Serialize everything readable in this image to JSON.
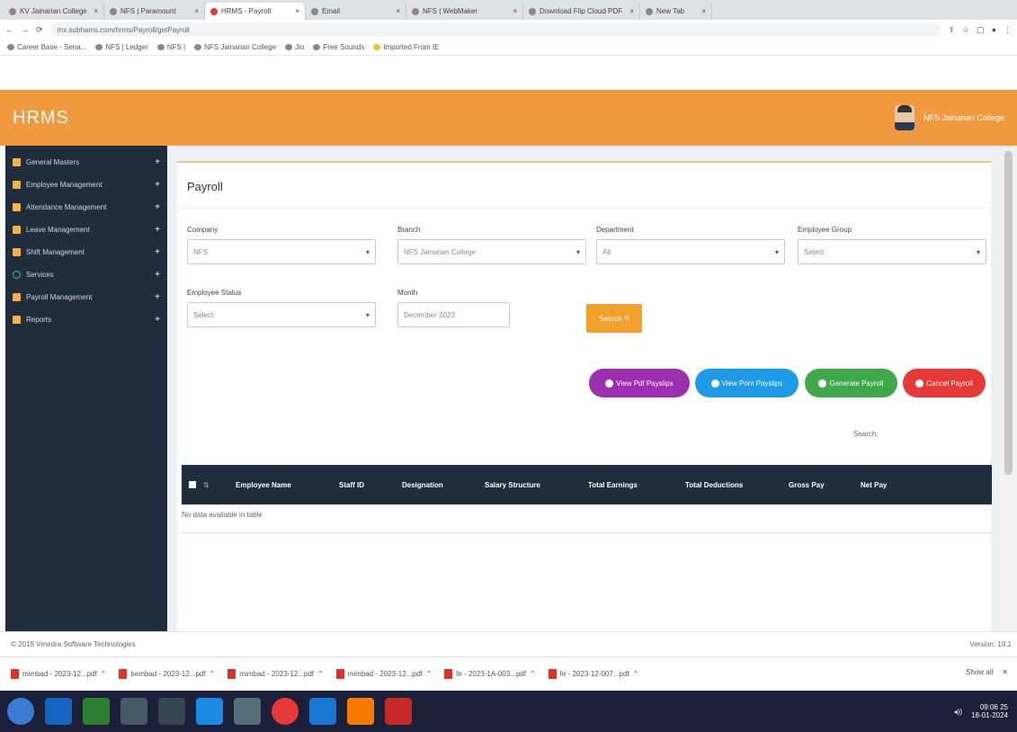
{
  "browser": {
    "tabs": [
      {
        "title": "KV Jainarian College"
      },
      {
        "title": "NFS | Paramount"
      },
      {
        "title": "HRMS - Payroll"
      },
      {
        "title": "Email"
      },
      {
        "title": "NFS | WebMaker"
      },
      {
        "title": "Download Flip Cloud PDF"
      },
      {
        "title": "New Tab"
      }
    ],
    "url": "mx.subhams.com/hrms/Payroll/getPayroll",
    "bookmarks": [
      "Career Base - Sena...",
      "NFS | Ledger",
      "NFS |",
      "NFS Jainarian College",
      "Jio",
      "Free Sounds",
      "Imported From IE"
    ]
  },
  "app": {
    "brand": "HRMS",
    "user_name": "NFS Jainarian College",
    "accent": "#f0993f",
    "sidebar_bg": "#1f2d3d"
  },
  "sidebar": {
    "items": [
      {
        "label": "General Masters",
        "icon": "folder-icon"
      },
      {
        "label": "Employee Management",
        "icon": "users-icon"
      },
      {
        "label": "Attendance Management",
        "icon": "calendar-icon"
      },
      {
        "label": "Leave Management",
        "icon": "calendar-icon"
      },
      {
        "label": "Shift Management",
        "icon": "clock-icon"
      },
      {
        "label": "Services",
        "icon": "gear-icon"
      },
      {
        "label": "Payroll Management",
        "icon": "chart-icon"
      },
      {
        "label": "Reports",
        "icon": "file-icon"
      }
    ]
  },
  "page": {
    "title": "Payroll",
    "filters": {
      "company": {
        "label": "Company",
        "value": "NFS"
      },
      "branch": {
        "label": "Branch",
        "value": "NFS Jainarian College"
      },
      "department": {
        "label": "Department",
        "value": "All"
      },
      "employee_group": {
        "label": "Employee Group",
        "value": "Select"
      },
      "employee_status": {
        "label": "Employee Status",
        "value": "Select"
      },
      "month": {
        "label": "Month",
        "value": "December 2023"
      }
    },
    "search_button": "Search",
    "actions": [
      {
        "label": "View Pdf Payslips",
        "color": "#9b2fae"
      },
      {
        "label": "View Print Payslips",
        "color": "#1e9be6"
      },
      {
        "label": "Generate Payroll",
        "color": "#3ea84a"
      },
      {
        "label": "Cancel Payroll",
        "color": "#e53935"
      }
    ],
    "search_label": "Search:",
    "table": {
      "columns": [
        "Employee Name",
        "Staff ID",
        "Designation",
        "Salary Structure",
        "Total Earnings",
        "Total Deductions",
        "Gross Pay",
        "Net Pay"
      ],
      "empty": "No data available in table"
    }
  },
  "footer": {
    "copyright": "© 2019 Vmedra Software Technologies",
    "version": "Version: 19.1"
  },
  "downloads": {
    "items": [
      "mimbad - 2023-12...pdf",
      "bembad - 2023-12...pdf",
      "mimbad - 2023-12...pdf",
      "mimbad - 2023-12...pdf",
      "fe - 2023-1A-003...pdf",
      "fe - 2023-12-007...pdf"
    ],
    "show_all": "Show all"
  },
  "tray": {
    "time": "09:06 25",
    "date": "18-01-2024"
  }
}
